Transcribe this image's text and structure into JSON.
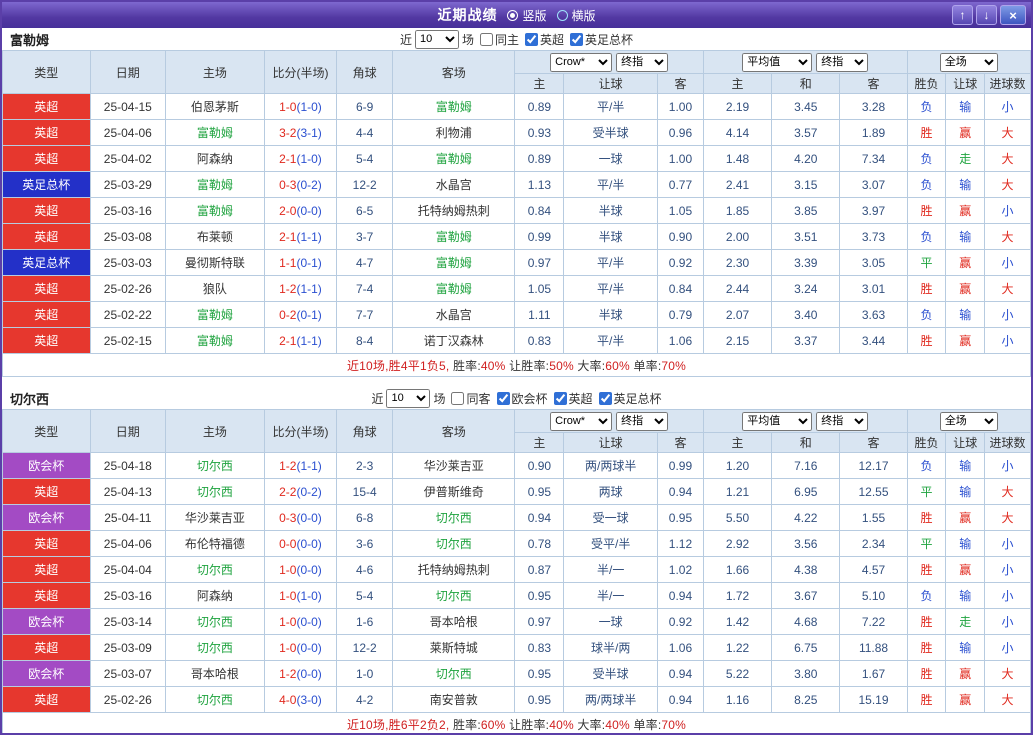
{
  "titlebar": {
    "title": "近期战绩",
    "radios": [
      {
        "label": "竖版",
        "selected": true
      },
      {
        "label": "横版",
        "selected": false
      }
    ],
    "up_icon": "↑",
    "down_icon": "↓",
    "close_icon": "×"
  },
  "table_header": {
    "static_cols": [
      "类型",
      "日期",
      "主场",
      "比分(半场)",
      "角球",
      "客场"
    ],
    "asia_dropdowns": [
      "Crow*",
      "终指"
    ],
    "asia_cols": [
      "主",
      "让球",
      "客"
    ],
    "euro_dropdowns": [
      "平均值",
      "终指"
    ],
    "euro_cols": [
      "主",
      "和",
      "客"
    ],
    "scope_dropdown": "全场",
    "result_cols": [
      "胜负",
      "让球",
      "进球数"
    ]
  },
  "color_map": {
    "league": {
      "英超": "#e6372e",
      "英足总杯": "#2330c8",
      "欧会杯": "#a34bc4"
    },
    "result": {
      "胜": "#e0291e",
      "平": "#1fa33f",
      "负": "#2a4fd0"
    },
    "handicap": {
      "赢": "#e0291e",
      "走": "#1fa33f",
      "输": "#2a4fd0"
    },
    "goals": {
      "大": "#e0291e",
      "小": "#2a4fd0"
    }
  },
  "sections": [
    {
      "team": "富勒姆",
      "filter": {
        "near_label": "近",
        "count": "10",
        "unit_label": "场",
        "checkboxes": [
          {
            "label": "同主",
            "checked": false
          },
          {
            "label": "英超",
            "checked": true
          },
          {
            "label": "英足总杯",
            "checked": true
          }
        ]
      },
      "rows": [
        {
          "league": "英超",
          "date": "25-04-15",
          "home": "伯恩茅斯",
          "home_is_team": false,
          "score": "1-0",
          "half": "(1-0)",
          "corner": "6-9",
          "away": "富勒姆",
          "away_is_team": true,
          "asia": [
            "0.89",
            "平/半",
            "1.00"
          ],
          "euro": [
            "2.19",
            "3.45",
            "3.28"
          ],
          "result": "负",
          "handicap": "输",
          "goals": "小"
        },
        {
          "league": "英超",
          "date": "25-04-06",
          "home": "富勒姆",
          "home_is_team": true,
          "score": "3-2",
          "half": "(3-1)",
          "corner": "4-4",
          "away": "利物浦",
          "away_is_team": false,
          "asia": [
            "0.93",
            "受半球",
            "0.96"
          ],
          "euro": [
            "4.14",
            "3.57",
            "1.89"
          ],
          "result": "胜",
          "handicap": "赢",
          "goals": "大"
        },
        {
          "league": "英超",
          "date": "25-04-02",
          "home": "阿森纳",
          "home_is_team": false,
          "score": "2-1",
          "half": "(1-0)",
          "corner": "5-4",
          "away": "富勒姆",
          "away_is_team": true,
          "asia": [
            "0.89",
            "一球",
            "1.00"
          ],
          "euro": [
            "1.48",
            "4.20",
            "7.34"
          ],
          "result": "负",
          "handicap": "走",
          "goals": "大"
        },
        {
          "league": "英足总杯",
          "date": "25-03-29",
          "home": "富勒姆",
          "home_is_team": true,
          "score": "0-3",
          "half": "(0-2)",
          "corner": "12-2",
          "away": "水晶宫",
          "away_is_team": false,
          "asia": [
            "1.13",
            "平/半",
            "0.77"
          ],
          "euro": [
            "2.41",
            "3.15",
            "3.07"
          ],
          "result": "负",
          "handicap": "输",
          "goals": "大"
        },
        {
          "league": "英超",
          "date": "25-03-16",
          "home": "富勒姆",
          "home_is_team": true,
          "score": "2-0",
          "half": "(0-0)",
          "corner": "6-5",
          "away": "托特纳姆热刺",
          "away_is_team": false,
          "asia": [
            "0.84",
            "半球",
            "1.05"
          ],
          "euro": [
            "1.85",
            "3.85",
            "3.97"
          ],
          "result": "胜",
          "handicap": "赢",
          "goals": "小"
        },
        {
          "league": "英超",
          "date": "25-03-08",
          "home": "布莱顿",
          "home_is_team": false,
          "score": "2-1",
          "half": "(1-1)",
          "corner": "3-7",
          "away": "富勒姆",
          "away_is_team": true,
          "asia": [
            "0.99",
            "半球",
            "0.90"
          ],
          "euro": [
            "2.00",
            "3.51",
            "3.73"
          ],
          "result": "负",
          "handicap": "输",
          "goals": "大"
        },
        {
          "league": "英足总杯",
          "date": "25-03-03",
          "home": "曼彻斯特联",
          "home_is_team": false,
          "score": "1-1",
          "half": "(0-1)",
          "corner": "4-7",
          "away": "富勒姆",
          "away_is_team": true,
          "asia": [
            "0.97",
            "平/半",
            "0.92"
          ],
          "euro": [
            "2.30",
            "3.39",
            "3.05"
          ],
          "result": "平",
          "handicap": "赢",
          "goals": "小"
        },
        {
          "league": "英超",
          "date": "25-02-26",
          "home": "狼队",
          "home_is_team": false,
          "score": "1-2",
          "half": "(1-1)",
          "corner": "7-4",
          "away": "富勒姆",
          "away_is_team": true,
          "asia": [
            "1.05",
            "平/半",
            "0.84"
          ],
          "euro": [
            "2.44",
            "3.24",
            "3.01"
          ],
          "result": "胜",
          "handicap": "赢",
          "goals": "大"
        },
        {
          "league": "英超",
          "date": "25-02-22",
          "home": "富勒姆",
          "home_is_team": true,
          "score": "0-2",
          "half": "(0-1)",
          "corner": "7-7",
          "away": "水晶宫",
          "away_is_team": false,
          "asia": [
            "1.11",
            "半球",
            "0.79"
          ],
          "euro": [
            "2.07",
            "3.40",
            "3.63"
          ],
          "result": "负",
          "handicap": "输",
          "goals": "小"
        },
        {
          "league": "英超",
          "date": "25-02-15",
          "home": "富勒姆",
          "home_is_team": true,
          "score": "2-1",
          "half": "(1-1)",
          "corner": "8-4",
          "away": "诺丁汉森林",
          "away_is_team": false,
          "asia": [
            "0.83",
            "平/半",
            "1.06"
          ],
          "euro": [
            "2.15",
            "3.37",
            "3.44"
          ],
          "result": "胜",
          "handicap": "赢",
          "goals": "小"
        }
      ],
      "summary": [
        {
          "text": "近10场,胜4平1负5, ",
          "color": "#d02020"
        },
        {
          "text": "胜率:",
          "color": "#333333"
        },
        {
          "text": "40%",
          "color": "#d02020"
        },
        {
          "text": " 让胜率:",
          "color": "#333333"
        },
        {
          "text": "50%",
          "color": "#d02020"
        },
        {
          "text": " 大率:",
          "color": "#333333"
        },
        {
          "text": "60%",
          "color": "#d02020"
        },
        {
          "text": " 单率:",
          "color": "#333333"
        },
        {
          "text": "70%",
          "color": "#d02020"
        }
      ]
    },
    {
      "team": "切尔西",
      "filter": {
        "near_label": "近",
        "count": "10",
        "unit_label": "场",
        "checkboxes": [
          {
            "label": "同客",
            "checked": false
          },
          {
            "label": "欧会杯",
            "checked": true
          },
          {
            "label": "英超",
            "checked": true
          },
          {
            "label": "英足总杯",
            "checked": true
          }
        ]
      },
      "rows": [
        {
          "league": "欧会杯",
          "date": "25-04-18",
          "home": "切尔西",
          "home_is_team": true,
          "score": "1-2",
          "half": "(1-1)",
          "corner": "2-3",
          "away": "华沙莱吉亚",
          "away_is_team": false,
          "asia": [
            "0.90",
            "两/两球半",
            "0.99"
          ],
          "euro": [
            "1.20",
            "7.16",
            "12.17"
          ],
          "result": "负",
          "handicap": "输",
          "goals": "小"
        },
        {
          "league": "英超",
          "date": "25-04-13",
          "home": "切尔西",
          "home_is_team": true,
          "score": "2-2",
          "half": "(0-2)",
          "corner": "15-4",
          "away": "伊普斯维奇",
          "away_is_team": false,
          "asia": [
            "0.95",
            "两球",
            "0.94"
          ],
          "euro": [
            "1.21",
            "6.95",
            "12.55"
          ],
          "result": "平",
          "handicap": "输",
          "goals": "大"
        },
        {
          "league": "欧会杯",
          "date": "25-04-11",
          "home": "华沙莱吉亚",
          "home_is_team": false,
          "score": "0-3",
          "half": "(0-0)",
          "corner": "6-8",
          "away": "切尔西",
          "away_is_team": true,
          "asia": [
            "0.94",
            "受一球",
            "0.95"
          ],
          "euro": [
            "5.50",
            "4.22",
            "1.55"
          ],
          "result": "胜",
          "handicap": "赢",
          "goals": "大"
        },
        {
          "league": "英超",
          "date": "25-04-06",
          "home": "布伦特福德",
          "home_is_team": false,
          "score": "0-0",
          "half": "(0-0)",
          "corner": "3-6",
          "away": "切尔西",
          "away_is_team": true,
          "asia": [
            "0.78",
            "受平/半",
            "1.12"
          ],
          "euro": [
            "2.92",
            "3.56",
            "2.34"
          ],
          "result": "平",
          "handicap": "输",
          "goals": "小"
        },
        {
          "league": "英超",
          "date": "25-04-04",
          "home": "切尔西",
          "home_is_team": true,
          "score": "1-0",
          "half": "(0-0)",
          "corner": "4-6",
          "away": "托特纳姆热刺",
          "away_is_team": false,
          "asia": [
            "0.87",
            "半/一",
            "1.02"
          ],
          "euro": [
            "1.66",
            "4.38",
            "4.57"
          ],
          "result": "胜",
          "handicap": "赢",
          "goals": "小"
        },
        {
          "league": "英超",
          "date": "25-03-16",
          "home": "阿森纳",
          "home_is_team": false,
          "score": "1-0",
          "half": "(1-0)",
          "corner": "5-4",
          "away": "切尔西",
          "away_is_team": true,
          "asia": [
            "0.95",
            "半/一",
            "0.94"
          ],
          "euro": [
            "1.72",
            "3.67",
            "5.10"
          ],
          "result": "负",
          "handicap": "输",
          "goals": "小"
        },
        {
          "league": "欧会杯",
          "date": "25-03-14",
          "home": "切尔西",
          "home_is_team": true,
          "score": "1-0",
          "half": "(0-0)",
          "corner": "1-6",
          "away": "哥本哈根",
          "away_is_team": false,
          "asia": [
            "0.97",
            "一球",
            "0.92"
          ],
          "euro": [
            "1.42",
            "4.68",
            "7.22"
          ],
          "result": "胜",
          "handicap": "走",
          "goals": "小"
        },
        {
          "league": "英超",
          "date": "25-03-09",
          "home": "切尔西",
          "home_is_team": true,
          "score": "1-0",
          "half": "(0-0)",
          "corner": "12-2",
          "away": "莱斯特城",
          "away_is_team": false,
          "asia": [
            "0.83",
            "球半/两",
            "1.06"
          ],
          "euro": [
            "1.22",
            "6.75",
            "11.88"
          ],
          "result": "胜",
          "handicap": "输",
          "goals": "小"
        },
        {
          "league": "欧会杯",
          "date": "25-03-07",
          "home": "哥本哈根",
          "home_is_team": false,
          "score": "1-2",
          "half": "(0-0)",
          "corner": "1-0",
          "away": "切尔西",
          "away_is_team": true,
          "asia": [
            "0.95",
            "受半球",
            "0.94"
          ],
          "euro": [
            "5.22",
            "3.80",
            "1.67"
          ],
          "result": "胜",
          "handicap": "赢",
          "goals": "大"
        },
        {
          "league": "英超",
          "date": "25-02-26",
          "home": "切尔西",
          "home_is_team": true,
          "score": "4-0",
          "half": "(3-0)",
          "corner": "4-2",
          "away": "南安普敦",
          "away_is_team": false,
          "asia": [
            "0.95",
            "两/两球半",
            "0.94"
          ],
          "euro": [
            "1.16",
            "8.25",
            "15.19"
          ],
          "result": "胜",
          "handicap": "赢",
          "goals": "大"
        }
      ],
      "summary": [
        {
          "text": "近10场,胜6平2负2, ",
          "color": "#d02020"
        },
        {
          "text": "胜率:",
          "color": "#333333"
        },
        {
          "text": "60%",
          "color": "#d02020"
        },
        {
          "text": " 让胜率:",
          "color": "#333333"
        },
        {
          "text": "40%",
          "color": "#d02020"
        },
        {
          "text": " 大率:",
          "color": "#333333"
        },
        {
          "text": "40%",
          "color": "#d02020"
        },
        {
          "text": " 单率:",
          "color": "#333333"
        },
        {
          "text": "70%",
          "color": "#d02020"
        }
      ]
    }
  ]
}
